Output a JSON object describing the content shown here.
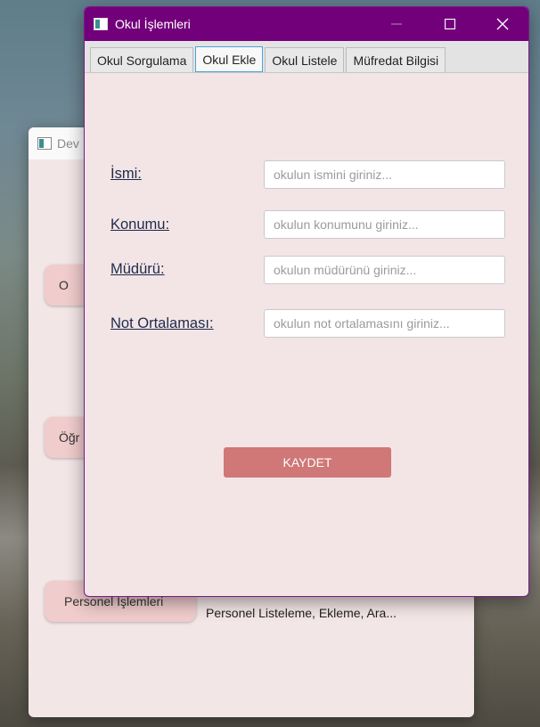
{
  "background_window": {
    "title": "Dev",
    "buttons": [
      {
        "label": "O"
      },
      {
        "label": "Öğr"
      },
      {
        "label": "Personel İşlemleri"
      }
    ],
    "personel_description": "Personel Listeleme, Ekleme, Ara..."
  },
  "window": {
    "title": "Okul İşlemleri",
    "controls": {
      "minimize": "—",
      "maximize": "☐",
      "close": "✕"
    }
  },
  "tabs": [
    {
      "label": "Okul Sorgulama",
      "active": false
    },
    {
      "label": "Okul Ekle",
      "active": true
    },
    {
      "label": "Okul Listele",
      "active": false
    },
    {
      "label": "Müfredat Bilgisi",
      "active": false
    }
  ],
  "form": {
    "fields": [
      {
        "label": "İsmi:",
        "placeholder": "okulun ismini giriniz...",
        "value": ""
      },
      {
        "label": "Konumu:",
        "placeholder": "okulun konumunu giriniz...",
        "value": ""
      },
      {
        "label": "Müdürü:",
        "placeholder": "okulun müdürünü giriniz...",
        "value": ""
      },
      {
        "label": "Not Ortalaması:",
        "placeholder": "okulun not ortalamasını giriniz...",
        "value": ""
      }
    ],
    "save_label": "KAYDET"
  },
  "colors": {
    "titlebar": "#72007a",
    "save_button": "#d07777",
    "window_background": "#f3e5e5",
    "active_tab_border": "#4aa3d8"
  }
}
